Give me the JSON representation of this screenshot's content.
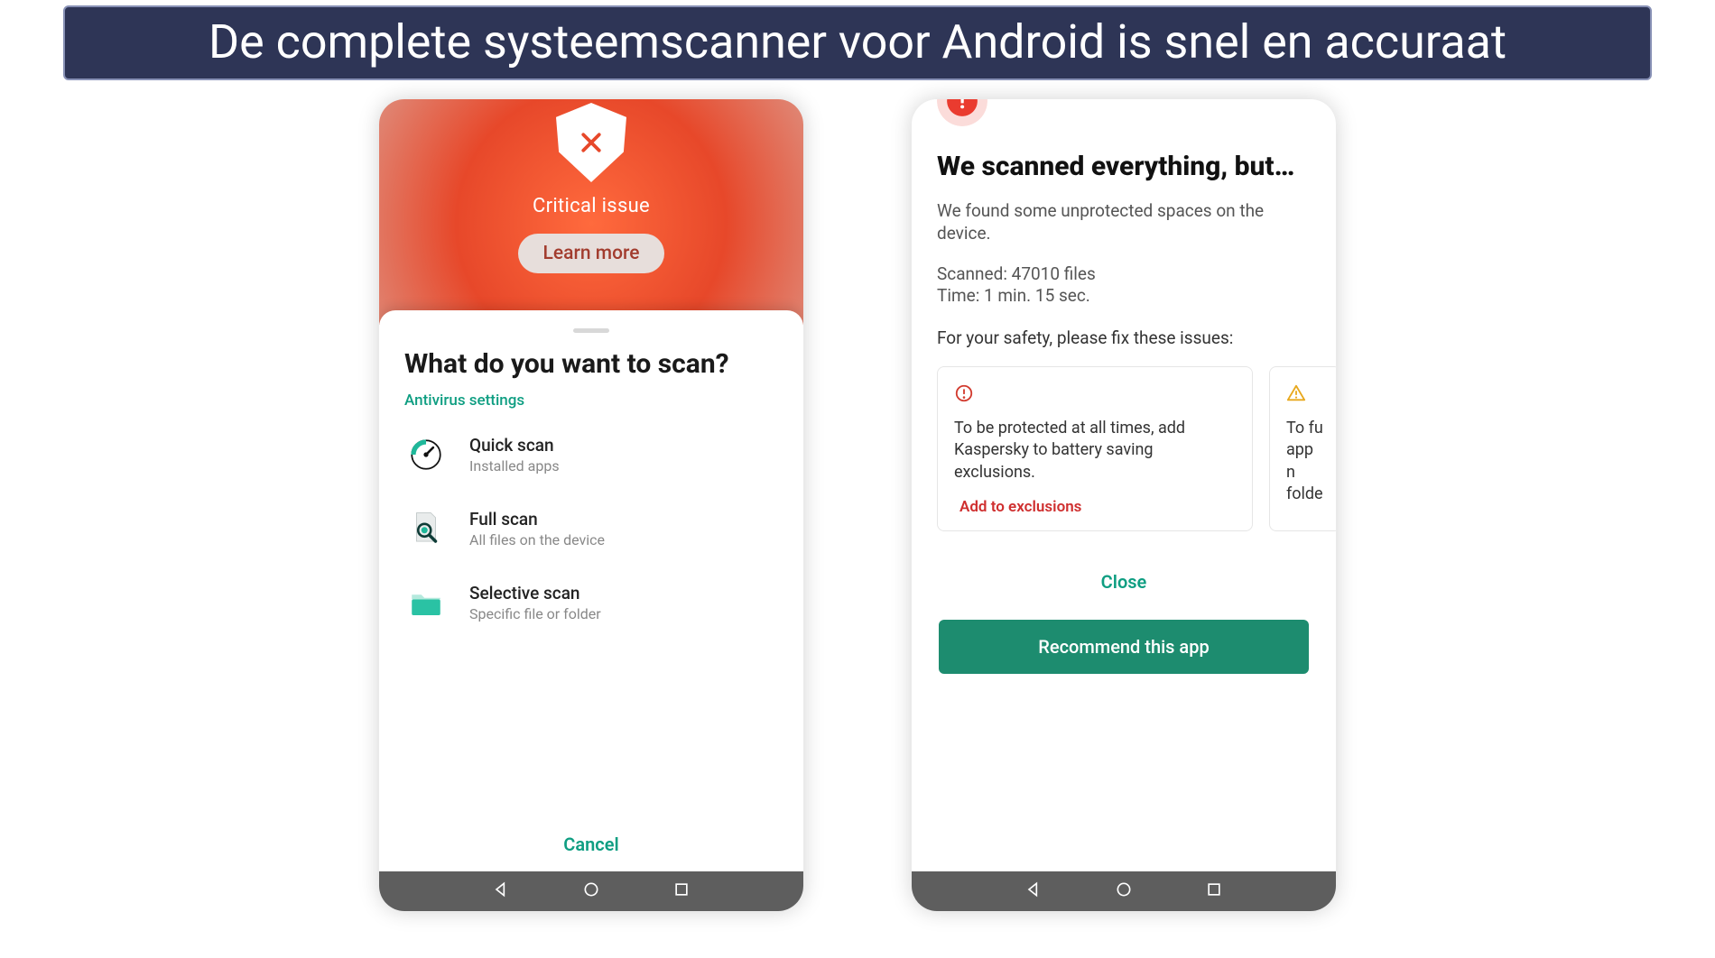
{
  "banner": {
    "title": "De complete systeemscanner voor Android is snel en accuraat"
  },
  "phone1": {
    "hero": {
      "status": "Critical issue",
      "learn": "Learn more"
    },
    "sheet": {
      "title": "What do you want to scan?",
      "settings_link": "Antivirus settings",
      "options": [
        {
          "title": "Quick scan",
          "sub": "Installed apps"
        },
        {
          "title": "Full scan",
          "sub": "All files on the device"
        },
        {
          "title": "Selective scan",
          "sub": "Specific file or folder"
        }
      ],
      "cancel": "Cancel"
    }
  },
  "phone2": {
    "title": "We scanned everything, but…",
    "subtitle": "We found some unprotected spaces on the device.",
    "scanned_label": "Scanned: 47010 files",
    "time_label": "Time: 1 min. 15 sec.",
    "fix_prompt": "For your safety, please fix these issues:",
    "cards": [
      {
        "msg": "To be protected at all times, add Kaspersky to battery saving exclusions.",
        "action": "Add to exclusions"
      },
      {
        "msg_partial": "To fu\napp n\nfolde"
      }
    ],
    "close": "Close",
    "recommend": "Recommend this app"
  }
}
